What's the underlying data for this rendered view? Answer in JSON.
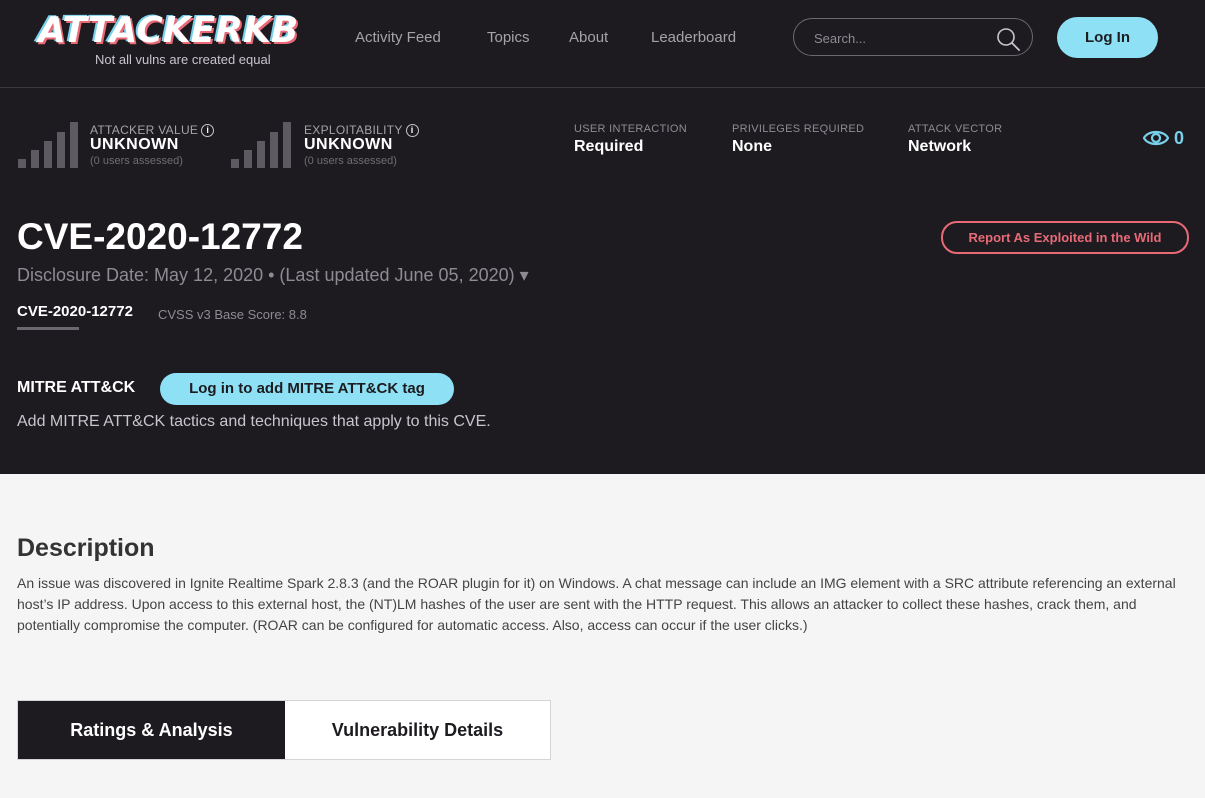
{
  "brand": {
    "logo_text": "ATTACKERKB",
    "tagline": "Not all vulns are created equal"
  },
  "nav": {
    "items": [
      "Activity Feed",
      "Topics",
      "About",
      "Leaderboard"
    ]
  },
  "search": {
    "placeholder": "Search..."
  },
  "auth": {
    "login_label": "Log In"
  },
  "metrics": {
    "attacker_value": {
      "label": "ATTACKER VALUE",
      "value": "UNKNOWN",
      "sub": "(0 users assessed)"
    },
    "exploitability": {
      "label": "EXPLOITABILITY",
      "value": "UNKNOWN",
      "sub": "(0 users assessed)"
    }
  },
  "attributes": [
    {
      "label": "USER INTERACTION",
      "value": "Required"
    },
    {
      "label": "PRIVILEGES REQUIRED",
      "value": "None"
    },
    {
      "label": "ATTACK VECTOR",
      "value": "Network"
    }
  ],
  "views": {
    "count": "0"
  },
  "cve": {
    "title": "CVE-2020-12772",
    "report_label": "Report As Exploited in the Wild",
    "disclosure": "Disclosure Date: May 12, 2020 • (Last updated June 05, 2020) ▾",
    "sub_tab": "CVE-2020-12772",
    "cvss": "CVSS v3 Base Score: 8.8"
  },
  "mitre": {
    "title": "MITRE ATT&CK",
    "button_label": "Log in to add MITRE ATT&CK tag",
    "description": "Add MITRE ATT&CK tactics and techniques that apply to this CVE."
  },
  "description": {
    "title": "Description",
    "text": "An issue was discovered in Ignite Realtime Spark 2.8.3 (and the ROAR plugin for it) on Windows. A chat message can include an IMG element with a SRC attribute referencing an external host’s IP address. Upon access to this external host, the (NT)LM hashes of the user are sent with the HTTP request. This allows an attacker to collect these hashes, crack them, and potentially compromise the computer. (ROAR can be configured for automatic access. Also, access can occur if the user clicks.)"
  },
  "tabs": [
    "Ratings & Analysis",
    "Vulnerability Details"
  ],
  "colors": {
    "accent": "#8ee0f5",
    "danger": "#e86a77",
    "dark_bg": "#1d1b20",
    "light_bg": "#f5f5f5"
  }
}
